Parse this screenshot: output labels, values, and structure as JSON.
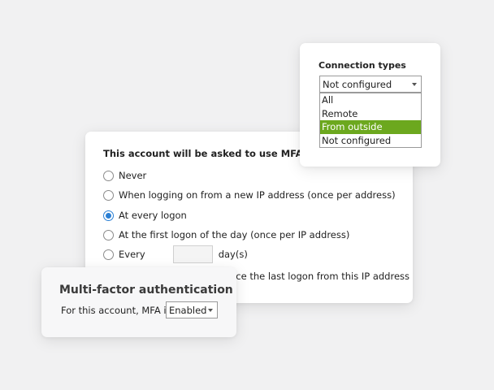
{
  "mfa_panel": {
    "heading": "This account will be asked to use MFA:",
    "options": [
      {
        "label": "Never",
        "checked": false
      },
      {
        "label": "When logging on from a new IP address (once per address)",
        "checked": false
      },
      {
        "label": "At every logon",
        "checked": true
      },
      {
        "label": "At the first logon of the day (once per IP address)",
        "checked": false
      }
    ],
    "every_option": {
      "prefix": "Every",
      "days_value": "",
      "suffix": "day(s)",
      "checked": false
    },
    "partial_line": "nce the last logon from this IP address"
  },
  "connection_panel": {
    "title": "Connection types",
    "selected": "Not configured",
    "dropdown_items": [
      "All",
      "Remote",
      "From outside",
      "Not configured"
    ],
    "highlighted_item": "From outside"
  },
  "multifactor_panel": {
    "title": "Multi-factor authentication",
    "label": "For this account, MFA is",
    "selected": "Enabled"
  },
  "colors": {
    "accent_blue": "#2a7fd4",
    "highlight_green": "#6ca81e",
    "background": "#f1f1f2"
  },
  "icons": {
    "radio": "radio-icon",
    "dropdown_arrow": "chevron-down-icon"
  }
}
